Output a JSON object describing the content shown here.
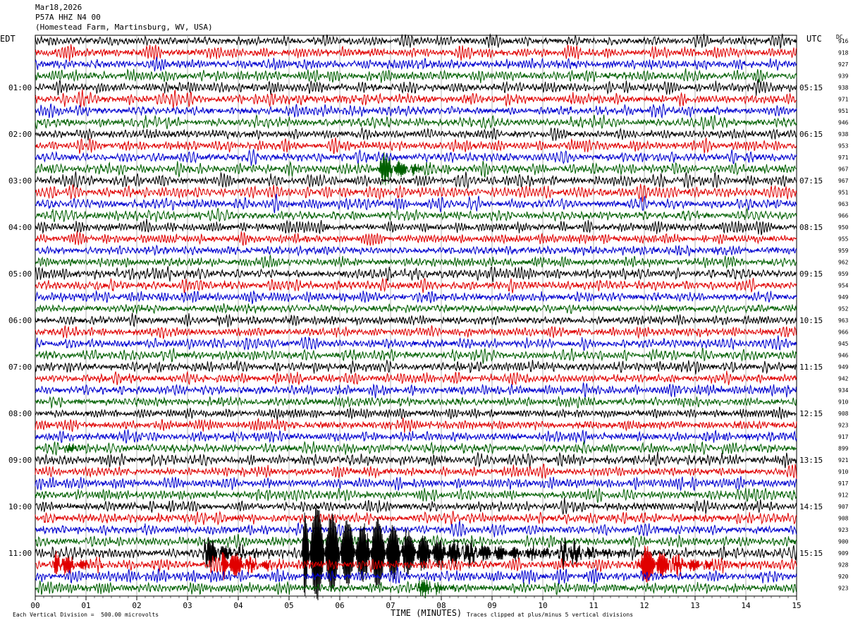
{
  "header": {
    "date": "Mar18,2026",
    "station": "P57A HHZ N4 00",
    "location": "(Homestead Farm, Martinsburg, WV, USA)"
  },
  "left_axis_label": "EDT",
  "right_axis_label": "UTC",
  "dc_label": "DC",
  "footer": {
    "scale_note": "Each Vertical Division =  500.00 microvolts",
    "xlabel": "TIME (MINUTES)",
    "clip_note": "Traces clipped at plus/minus 5 vertical divisions"
  },
  "colors": {
    "trace_cycle": [
      "#000000",
      "#e00000",
      "#0000d0",
      "#006000"
    ],
    "grid": "#808080"
  },
  "chart_data": {
    "type": "line",
    "title": "P57A HHZ N4 00",
    "xlabel": "TIME (MINUTES)",
    "xlim": [
      0,
      15
    ],
    "x_ticks": [
      "00",
      "01",
      "02",
      "03",
      "04",
      "05",
      "06",
      "07",
      "08",
      "09",
      "10",
      "11",
      "12",
      "13",
      "14",
      "15"
    ],
    "left_time_labels": [
      "01:00",
      "02:00",
      "03:00",
      "04:00",
      "05:00",
      "06:00",
      "07:00",
      "08:00",
      "09:00",
      "10:00",
      "11:00"
    ],
    "right_time_labels": [
      "05:15",
      "06:15",
      "07:15",
      "08:15",
      "09:15",
      "10:15",
      "11:15",
      "12:15",
      "13:15",
      "14:15",
      "15:15"
    ],
    "row_count": 48,
    "dc_offsets": [
      "916",
      "918",
      "927",
      "939",
      "938",
      "971",
      "951",
      "946",
      "938",
      "953",
      "971",
      "967",
      "967",
      "951",
      "963",
      "966",
      "950",
      "955",
      "959",
      "962",
      "959",
      "954",
      "949",
      "952",
      "963",
      "966",
      "945",
      "946",
      "949",
      "942",
      "934",
      "910",
      "908",
      "923",
      "917",
      "899",
      "921",
      "910",
      "917",
      "912",
      "907",
      "908",
      "923",
      "900",
      "909",
      "928",
      "920",
      "923"
    ],
    "events": [
      {
        "row": 11,
        "minute": 6.8,
        "amplitude": 1.4
      },
      {
        "row": 35,
        "minute": 0.6,
        "amplitude": 0.5
      },
      {
        "row": 44,
        "minute": 3.3,
        "amplitude": 1.5
      },
      {
        "row": 44,
        "minute": 5.3,
        "amplitude": 5.0
      },
      {
        "row": 44,
        "minute": 6.6,
        "amplitude": 1.5
      },
      {
        "row": 44,
        "minute": 10.4,
        "amplitude": 1.0
      },
      {
        "row": 45,
        "minute": 0.4,
        "amplitude": 1.3
      },
      {
        "row": 45,
        "minute": 3.7,
        "amplitude": 1.6
      },
      {
        "row": 45,
        "minute": 11.9,
        "amplitude": 2.0
      },
      {
        "row": 47,
        "minute": 7.5,
        "amplitude": 1.0
      }
    ]
  }
}
